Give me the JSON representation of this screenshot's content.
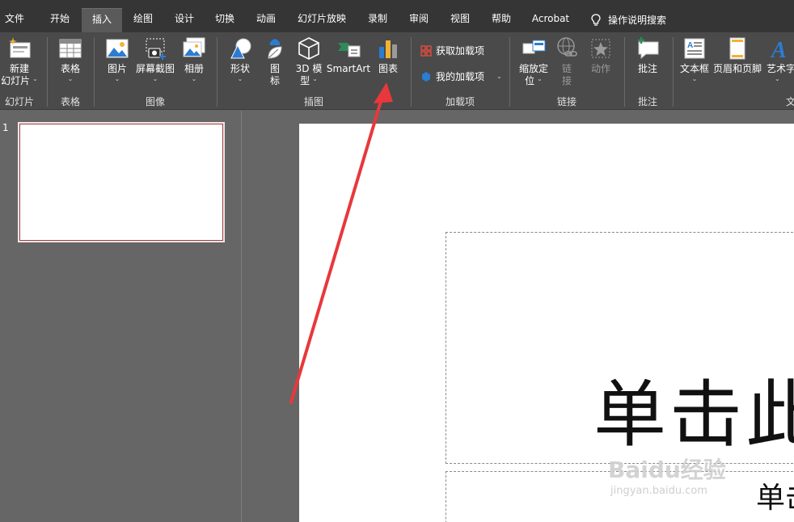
{
  "tabs": [
    "文件",
    "开始",
    "插入",
    "绘图",
    "设计",
    "切换",
    "动画",
    "幻灯片放映",
    "录制",
    "审阅",
    "视图",
    "帮助",
    "Acrobat"
  ],
  "active_tab": "插入",
  "search_label": "操作说明搜索",
  "ribbon": {
    "new_slide": {
      "line1": "新建",
      "line2": "幻灯片"
    },
    "table": "表格",
    "picture": "图片",
    "screenshot": "屏幕截图",
    "album": "相册",
    "shapes": "形状",
    "icons": {
      "line1": "图",
      "line2": "标"
    },
    "model3d": {
      "line1": "3D 模",
      "line2": "型"
    },
    "smartart": "SmartArt",
    "chart": "图表",
    "get_addins": "获取加载项",
    "my_addins": "我的加载项",
    "zoom": {
      "line1": "缩放定",
      "line2": "位"
    },
    "link": {
      "line1": "链",
      "line2": "接"
    },
    "action": "动作",
    "comment": "批注",
    "textbox": "文本框",
    "header_footer": "页眉和页脚",
    "wordart": "艺术字",
    "groups": {
      "slides": "幻灯片",
      "tables": "表格",
      "images": "图像",
      "illustrations": "插图",
      "addins": "加载项",
      "links": "链接",
      "comments": "批注",
      "text": "文"
    }
  },
  "thumbnail": {
    "number": "1"
  },
  "slide": {
    "title": "单击此",
    "subtitle": "单击"
  },
  "watermark": {
    "text": "Baidu经验",
    "url": "jingyan.baidu.com"
  },
  "colors": {
    "accent_arrow": "#e8383b",
    "tab_bar": "#353535",
    "ribbon": "#4a4a4a"
  }
}
